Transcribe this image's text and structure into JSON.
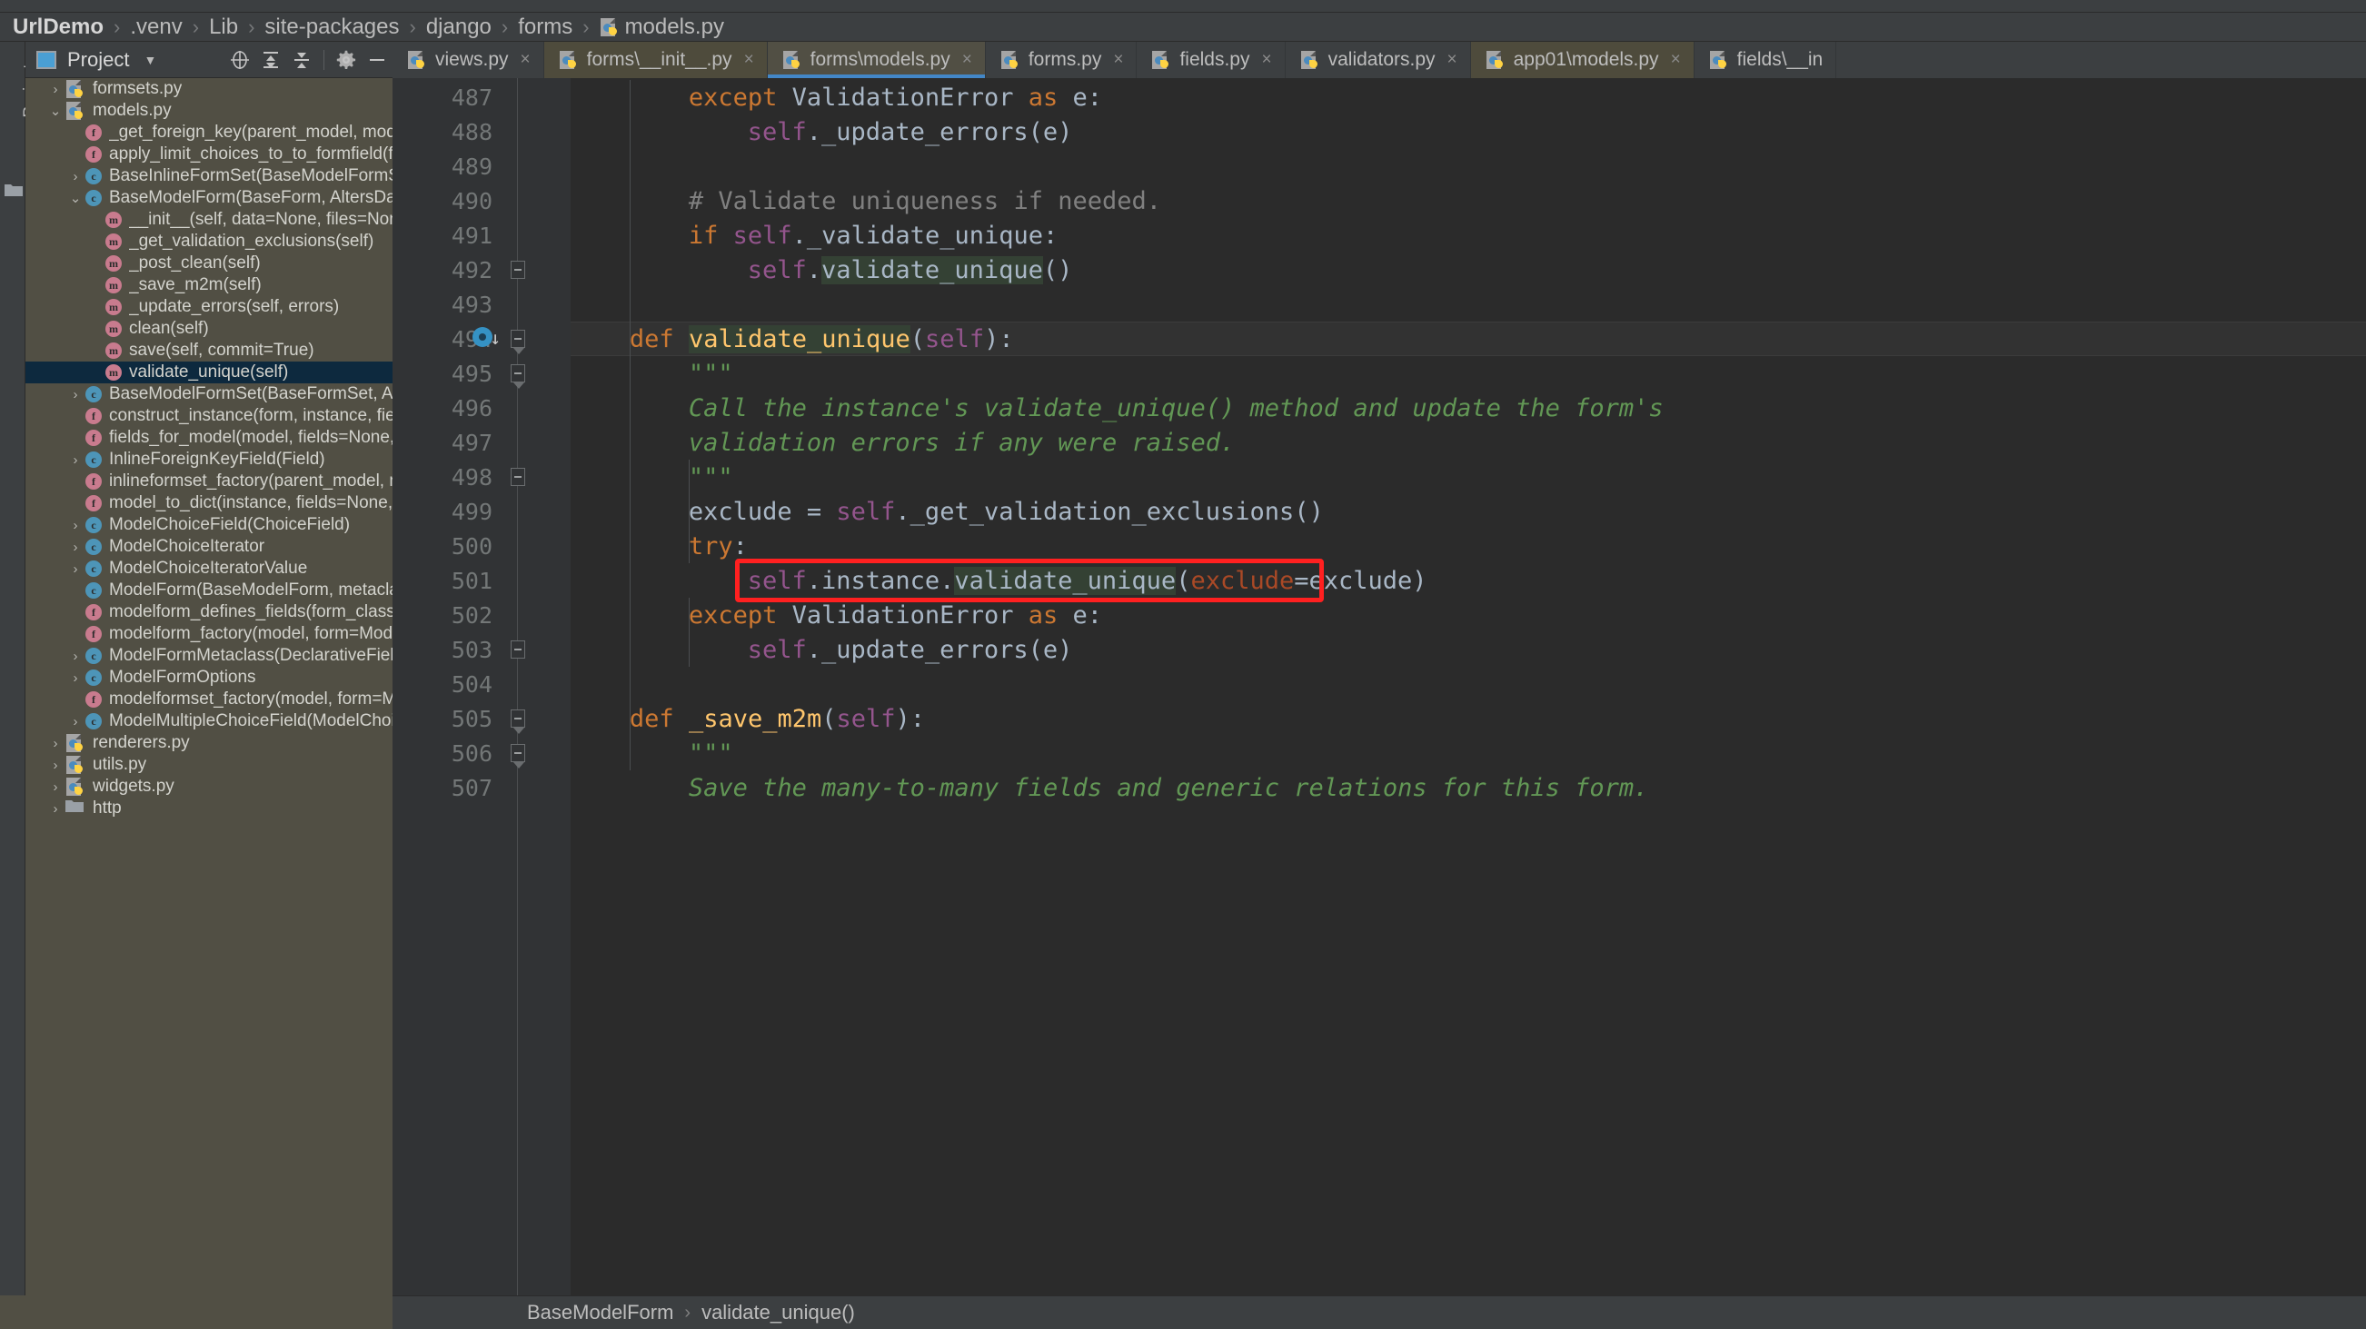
{
  "window": {
    "app": "PyCharm",
    "title": "UrlDemo"
  },
  "breadcrumb": {
    "items": [
      "UrlDemo",
      ".venv",
      "Lib",
      "site-packages",
      "django",
      "forms"
    ],
    "file": "models.py",
    "separator": "›"
  },
  "tool_strip": {
    "vertical_tab": "Project"
  },
  "project_panel": {
    "header_label": "Project",
    "caret": "▼",
    "tools": {
      "locate_icon": "crosshair-target-icon",
      "expand_all_icon": "expand-all-icon",
      "collapse_all_icon": "collapse-all-icon",
      "settings_icon": "gear-icon",
      "hide_icon": "minimize-icon"
    },
    "tree": [
      {
        "label": "formsets.py",
        "indent": 1,
        "arrow": "›",
        "icon": "python-file"
      },
      {
        "label": "models.py",
        "indent": 1,
        "arrow": "⌄",
        "icon": "python-file"
      },
      {
        "label": "_get_foreign_key(parent_model, model, fk_",
        "indent": 2,
        "arrow": "",
        "icon": "function"
      },
      {
        "label": "apply_limit_choices_to_to_formfield(formfi",
        "indent": 2,
        "arrow": "",
        "icon": "function"
      },
      {
        "label": "BaseInlineFormSet(BaseModelFormSet)",
        "indent": 2,
        "arrow": "›",
        "icon": "class"
      },
      {
        "label": "BaseModelForm(BaseForm, AltersData)",
        "indent": 2,
        "arrow": "⌄",
        "icon": "class"
      },
      {
        "label": "__init__(self, data=None, files=None, au",
        "indent": 3,
        "arrow": "",
        "icon": "method"
      },
      {
        "label": "_get_validation_exclusions(self)",
        "indent": 3,
        "arrow": "",
        "icon": "method"
      },
      {
        "label": "_post_clean(self)",
        "indent": 3,
        "arrow": "",
        "icon": "method"
      },
      {
        "label": "_save_m2m(self)",
        "indent": 3,
        "arrow": "",
        "icon": "method"
      },
      {
        "label": "_update_errors(self, errors)",
        "indent": 3,
        "arrow": "",
        "icon": "method"
      },
      {
        "label": "clean(self)",
        "indent": 3,
        "arrow": "",
        "icon": "method"
      },
      {
        "label": "save(self, commit=True)",
        "indent": 3,
        "arrow": "",
        "icon": "method"
      },
      {
        "label": "validate_unique(self)",
        "indent": 3,
        "arrow": "",
        "icon": "method",
        "selected": true
      },
      {
        "label": "BaseModelFormSet(BaseFormSet, AltersDa",
        "indent": 2,
        "arrow": "›",
        "icon": "class"
      },
      {
        "label": "construct_instance(form, instance, fields=",
        "indent": 2,
        "arrow": "",
        "icon": "function"
      },
      {
        "label": "fields_for_model(model, fields=None, excl",
        "indent": 2,
        "arrow": "",
        "icon": "function"
      },
      {
        "label": "InlineForeignKeyField(Field)",
        "indent": 2,
        "arrow": "›",
        "icon": "class"
      },
      {
        "label": "inlineformset_factory(parent_model, mode",
        "indent": 2,
        "arrow": "",
        "icon": "function"
      },
      {
        "label": "model_to_dict(instance, fields=None, exclu",
        "indent": 2,
        "arrow": "",
        "icon": "function"
      },
      {
        "label": "ModelChoiceField(ChoiceField)",
        "indent": 2,
        "arrow": "›",
        "icon": "class"
      },
      {
        "label": "ModelChoiceIterator",
        "indent": 2,
        "arrow": "›",
        "icon": "class"
      },
      {
        "label": "ModelChoiceIteratorValue",
        "indent": 2,
        "arrow": "›",
        "icon": "class"
      },
      {
        "label": "ModelForm(BaseModelForm, metaclass=N",
        "indent": 2,
        "arrow": "",
        "icon": "class"
      },
      {
        "label": "modelform_defines_fields(form_class)",
        "indent": 2,
        "arrow": "",
        "icon": "function"
      },
      {
        "label": "modelform_factory(model, form=ModelFo",
        "indent": 2,
        "arrow": "",
        "icon": "function"
      },
      {
        "label": "ModelFormMetaclass(DeclarativeFieldsMe",
        "indent": 2,
        "arrow": "›",
        "icon": "class"
      },
      {
        "label": "ModelFormOptions",
        "indent": 2,
        "arrow": "›",
        "icon": "class"
      },
      {
        "label": "modelformset_factory(model, form=Mode",
        "indent": 2,
        "arrow": "",
        "icon": "function"
      },
      {
        "label": "ModelMultipleChoiceField(ModelChoiceFi",
        "indent": 2,
        "arrow": "›",
        "icon": "class"
      },
      {
        "label": "renderers.py",
        "indent": 1,
        "arrow": "›",
        "icon": "python-file"
      },
      {
        "label": "utils.py",
        "indent": 1,
        "arrow": "›",
        "icon": "python-file"
      },
      {
        "label": "widgets.py",
        "indent": 1,
        "arrow": "›",
        "icon": "python-file"
      },
      {
        "label": "http",
        "indent": 1,
        "arrow": "›",
        "icon": "folder"
      }
    ]
  },
  "editor": {
    "tabs": [
      {
        "label": "views.py",
        "state": "normal",
        "close": "×"
      },
      {
        "label": "forms\\__init__.py",
        "state": "alt",
        "close": "×"
      },
      {
        "label": "forms\\models.py",
        "state": "active",
        "close": "×"
      },
      {
        "label": "forms.py",
        "state": "normal",
        "close": "×"
      },
      {
        "label": "fields.py",
        "state": "normal",
        "close": "×"
      },
      {
        "label": "validators.py",
        "state": "normal",
        "close": "×"
      },
      {
        "label": "app01\\models.py",
        "state": "alt",
        "close": "×"
      },
      {
        "label": "fields\\__in",
        "state": "normal",
        "close": ""
      }
    ],
    "first_line_number": 487,
    "lines": [
      {
        "n": 487,
        "indent": 8,
        "tokens": [
          {
            "t": "except ",
            "c": "kw"
          },
          {
            "t": "ValidationError",
            "c": "plain"
          },
          {
            "t": " ",
            "c": "plain"
          },
          {
            "t": "as",
            "c": "kw"
          },
          {
            "t": " e:",
            "c": "plain"
          }
        ]
      },
      {
        "n": 488,
        "indent": 12,
        "tokens": [
          {
            "t": "self",
            "c": "selfkw"
          },
          {
            "t": "._update_errors(e)",
            "c": "plain"
          }
        ]
      },
      {
        "n": 489,
        "indent": 0,
        "tokens": []
      },
      {
        "n": 490,
        "indent": 8,
        "tokens": [
          {
            "t": "# Validate uniqueness if needed.",
            "c": "cmt"
          }
        ]
      },
      {
        "n": 491,
        "indent": 8,
        "tokens": [
          {
            "t": "if ",
            "c": "kw"
          },
          {
            "t": "self",
            "c": "selfkw"
          },
          {
            "t": "._validate_unique:",
            "c": "plain"
          }
        ]
      },
      {
        "n": 492,
        "indent": 12,
        "tokens": [
          {
            "t": "self",
            "c": "selfkw"
          },
          {
            "t": ".",
            "c": "plain"
          },
          {
            "t": "validate_unique",
            "c": "hl"
          },
          {
            "t": "()",
            "c": "plain"
          }
        ],
        "fold": "up"
      },
      {
        "n": 493,
        "indent": 0,
        "tokens": []
      },
      {
        "n": 494,
        "indent": 4,
        "tokens": [
          {
            "t": "def ",
            "c": "kw"
          },
          {
            "t": "validate_unique",
            "c": "hlfn",
            "caret": true
          },
          {
            "t": "(",
            "c": "plain"
          },
          {
            "t": "self",
            "c": "selfkw"
          },
          {
            "t": "):",
            "c": "plain"
          }
        ],
        "fold": "down",
        "runmark": true,
        "current": true
      },
      {
        "n": 495,
        "indent": 8,
        "tokens": [
          {
            "t": "\"\"\"",
            "c": "docq"
          }
        ],
        "fold": "down"
      },
      {
        "n": 496,
        "indent": 8,
        "tokens": [
          {
            "t": "Call the instance's validate_unique() method and update the form's",
            "c": "doc"
          }
        ]
      },
      {
        "n": 497,
        "indent": 8,
        "tokens": [
          {
            "t": "validation errors if any were raised.",
            "c": "doc"
          }
        ]
      },
      {
        "n": 498,
        "indent": 8,
        "tokens": [
          {
            "t": "\"\"\"",
            "c": "docq"
          }
        ],
        "fold": "up"
      },
      {
        "n": 499,
        "indent": 8,
        "tokens": [
          {
            "t": "exclude = ",
            "c": "plain"
          },
          {
            "t": "self",
            "c": "selfkw"
          },
          {
            "t": "._get_validation_exclusions()",
            "c": "plain"
          }
        ]
      },
      {
        "n": 500,
        "indent": 8,
        "tokens": [
          {
            "t": "try",
            "c": "kw"
          },
          {
            "t": ":",
            "c": "plain"
          }
        ]
      },
      {
        "n": 501,
        "indent": 12,
        "tokens": [
          {
            "t": "self",
            "c": "selfkw"
          },
          {
            "t": ".instance.",
            "c": "plain"
          },
          {
            "t": "validate_unique",
            "c": "hl"
          },
          {
            "t": "(",
            "c": "plain"
          },
          {
            "t": "exclude",
            "c": "param"
          },
          {
            "t": "=exclude)",
            "c": "plain"
          }
        ],
        "boxed": true
      },
      {
        "n": 502,
        "indent": 8,
        "tokens": [
          {
            "t": "except ",
            "c": "kw"
          },
          {
            "t": "ValidationError",
            "c": "plain"
          },
          {
            "t": " ",
            "c": "plain"
          },
          {
            "t": "as",
            "c": "kw"
          },
          {
            "t": " e:",
            "c": "plain"
          }
        ]
      },
      {
        "n": 503,
        "indent": 12,
        "tokens": [
          {
            "t": "self",
            "c": "selfkw"
          },
          {
            "t": "._update_errors(e)",
            "c": "plain"
          }
        ],
        "fold": "up"
      },
      {
        "n": 504,
        "indent": 0,
        "tokens": []
      },
      {
        "n": 505,
        "indent": 4,
        "tokens": [
          {
            "t": "def ",
            "c": "kw"
          },
          {
            "t": "_save_m2m",
            "c": "fn"
          },
          {
            "t": "(",
            "c": "plain"
          },
          {
            "t": "self",
            "c": "selfkw"
          },
          {
            "t": "):",
            "c": "plain"
          }
        ],
        "fold": "down"
      },
      {
        "n": 506,
        "indent": 8,
        "tokens": [
          {
            "t": "\"\"\"",
            "c": "docq"
          }
        ],
        "fold": "down"
      },
      {
        "n": 507,
        "indent": 8,
        "tokens": [
          {
            "t": "Save the many-to-many fields and generic relations for this form.",
            "c": "doc"
          }
        ]
      }
    ],
    "annotation": {
      "type": "red-rectangle",
      "color": "#ff2020",
      "target_line": 501
    }
  },
  "status_breadcrumb": {
    "class": "BaseModelForm",
    "separator": "›",
    "method": "validate_unique()"
  },
  "colors": {
    "editor_bg": "#2b2b2b",
    "gutter_bg": "#313335",
    "panel_bg": "#514f44",
    "chrome_bg": "#3c3f41",
    "accent_blue": "#4387c7",
    "selection_navy": "#0d293e",
    "keyword_orange": "#cc7832",
    "function_yellow": "#ffc66d",
    "self_purple": "#94558d",
    "docstring_green": "#629755",
    "comment_gray": "#808080",
    "param_red": "#aa4926",
    "annotation_red": "#ff2020",
    "identifier_highlight": "#344134"
  }
}
